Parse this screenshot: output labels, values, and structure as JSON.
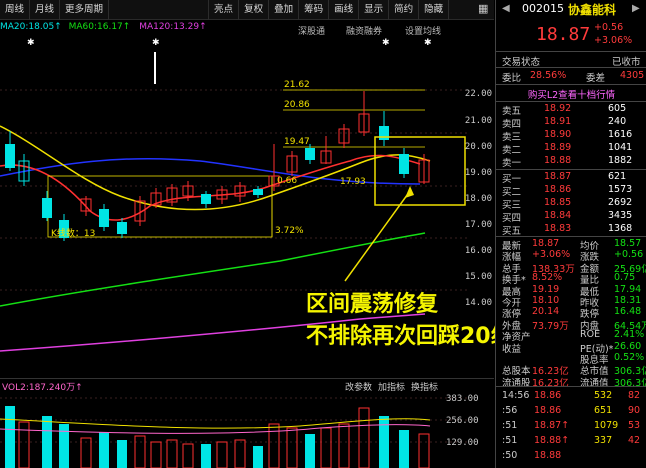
{
  "toolbar": {
    "items": [
      "周线",
      "月线",
      "更多周期",
      "亮点",
      "复权",
      "叠加",
      "筹码",
      "画线",
      "显示",
      "简约",
      "隐藏"
    ],
    "right_icon": "▦"
  },
  "ma": {
    "ma20": "MA20:18.05↑",
    "ma60": "MA60:16.17↑",
    "ma120": "MA120:13.29↑"
  },
  "chart_tools": [
    "深股通",
    "融资融券",
    "设置均线"
  ],
  "price_axis": [
    "22.00",
    "21.00",
    "20.00",
    "19.00",
    "18.00",
    "17.00",
    "16.00",
    "15.00",
    "14.00"
  ],
  "volume_axis": [
    "383.00",
    "256.00",
    "129.00"
  ],
  "volume_tools": [
    "改参数",
    "加指标",
    "换指标"
  ],
  "volume_label": "VOL2:187.240万↑",
  "chart_labels": {
    "p2162": "21.62",
    "p2086": "20.86",
    "p1947": "19.47",
    "p066": "0.66",
    "p1793": "17.93",
    "kcount": "K线数：13",
    "pct372": "3.72%"
  },
  "annotation": {
    "line1": "区间震荡修复",
    "line2": "不排除再次回踩20线"
  },
  "chart_data": {
    "type": "candlestick",
    "price_range": [
      14.0,
      22.0
    ],
    "overlays": [
      {
        "name": "MA20",
        "value": 18.05
      },
      {
        "name": "MA60",
        "value": 16.17
      },
      {
        "name": "MA120",
        "value": 13.29
      }
    ],
    "levels": [
      21.62,
      20.86,
      19.47,
      17.93
    ]
  },
  "quote": {
    "code": "002015",
    "name": "协鑫能科",
    "price": "18.87",
    "change": "+0.56",
    "change_pct": "+3.06%",
    "status_label": "交易状态",
    "status_value": "已收市",
    "weibi_label": "委比",
    "weibi_value": "28.56%",
    "weicha_label": "委差",
    "weicha_value": "4305",
    "l2_banner": "购买L2查看十档行情",
    "asks": [
      {
        "label": "卖五",
        "price": "18.92",
        "vol": "605"
      },
      {
        "label": "卖四",
        "price": "18.91",
        "vol": "240"
      },
      {
        "label": "卖三",
        "price": "18.90",
        "vol": "1616"
      },
      {
        "label": "卖二",
        "price": "18.89",
        "vol": "1041"
      },
      {
        "label": "卖一",
        "price": "18.88",
        "vol": "1882"
      }
    ],
    "bids": [
      {
        "label": "买一",
        "price": "18.87",
        "vol": "621"
      },
      {
        "label": "买二",
        "price": "18.86",
        "vol": "1573"
      },
      {
        "label": "买三",
        "price": "18.85",
        "vol": "2692"
      },
      {
        "label": "买四",
        "price": "18.84",
        "vol": "3435"
      },
      {
        "label": "买五",
        "price": "18.83",
        "vol": "1368"
      }
    ],
    "stats": [
      {
        "l1": "最新",
        "v1": "18.87",
        "l2": "均价",
        "v2": "18.57"
      },
      {
        "l1": "涨幅",
        "v1": "+3.06%",
        "l2": "涨跌",
        "v2": "+0.56"
      },
      {
        "l1": "总手",
        "v1": "138.33万",
        "l2": "金额",
        "v2": "25.69亿"
      },
      {
        "l1": "换手*",
        "v1": "8.52%",
        "l2": "量比",
        "v2": "0.75"
      },
      {
        "l1": "最高",
        "v1": "19.19",
        "l2": "最低",
        "v2": "17.94"
      },
      {
        "l1": "今开",
        "v1": "18.10",
        "l2": "昨收",
        "v2": "18.31"
      },
      {
        "l1": "涨停",
        "v1": "20.14",
        "l2": "跌停",
        "v2": "16.48"
      },
      {
        "l1": "外盘",
        "v1": "73.79万",
        "l2": "内盘",
        "v2": "64.54万"
      },
      {
        "l1": "净资产",
        "v1": "",
        "l2": "ROE",
        "v2": "2.41%"
      },
      {
        "l1": "收益",
        "v1": "",
        "l2": "PE(动)*",
        "v2": "26.60"
      },
      {
        "l1": "",
        "v1": "",
        "l2": "股息率",
        "v2": "0.52%"
      },
      {
        "l1": "总股本",
        "v1": "16.23亿",
        "l2": "总市值",
        "v2": "306.3亿"
      },
      {
        "l1": "流通股",
        "v1": "16.23亿",
        "l2": "流通值",
        "v2": "306.3亿"
      }
    ],
    "ticks": [
      {
        "time": "14:56",
        "price": "18.86",
        "vol": "532",
        "dir": "82"
      },
      {
        "time": ":56",
        "price": "18.86",
        "vol": "651",
        "dir": "90"
      },
      {
        "time": ":51",
        "price": "18.87↑",
        "vol": "1079",
        "dir": "53"
      },
      {
        "time": ":51",
        "price": "18.88↑",
        "vol": "337",
        "dir": "42"
      },
      {
        "time": ":50",
        "price": "18.88",
        "vol": "",
        "dir": ""
      }
    ]
  }
}
